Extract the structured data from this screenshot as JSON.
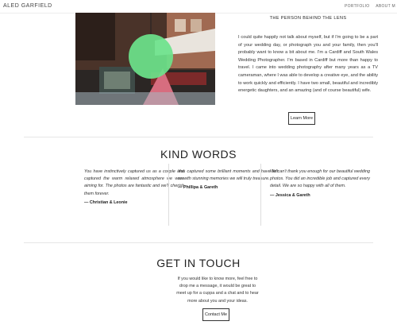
{
  "header": {
    "brand": "ALED GARFIELD",
    "nav": [
      "PORTFOLIO",
      "ABOUT M"
    ]
  },
  "about": {
    "title": "THE PERSON BEHIND THE LENS",
    "body": "I could quite happily not talk about myself, but if I'm going to be a part of your wedding day, or photograph you and your family, then you'll probably want to know a bit about me. I'm a Cardiff and South Wales Wedding Photographer. I'm based in Cardiff but more than happy to travel. I came into wedding photography after many years as a TV cameraman, where I was able to develop a creative eye, and the ability to work quickly and efficiently. I have two small, beautiful and incredibly energetic daughters, and an amazing (and of course beautiful) wife.",
    "button": "Learn More"
  },
  "kind_words": {
    "title": "KIND WORDS",
    "items": [
      {
        "quote": "You have instinctively captured us as a couple and captured the warm relaxed atmosphere we were aiming for. The photos are fantastic and we'll cherish them forever.",
        "author": "— Christian & Leonie"
      },
      {
        "quote": "You captured some brilliant moments and have left us with stunning memories we will truly treasure.",
        "author": "— Phillipa & Gareth"
      },
      {
        "quote": "We can't thank you enough for our beautiful wedding photos. You did an incredible job and captured every detail. We are so happy with all of them.",
        "author": "— Jessica & Gareth"
      }
    ]
  },
  "contact": {
    "title": "GET IN TOUCH",
    "body": "If you would like to know more, feel free to drop me a message, it would be great to meet up for a cuppa and a chat and to hear more about you and your ideas.",
    "button": "Contact Me"
  }
}
